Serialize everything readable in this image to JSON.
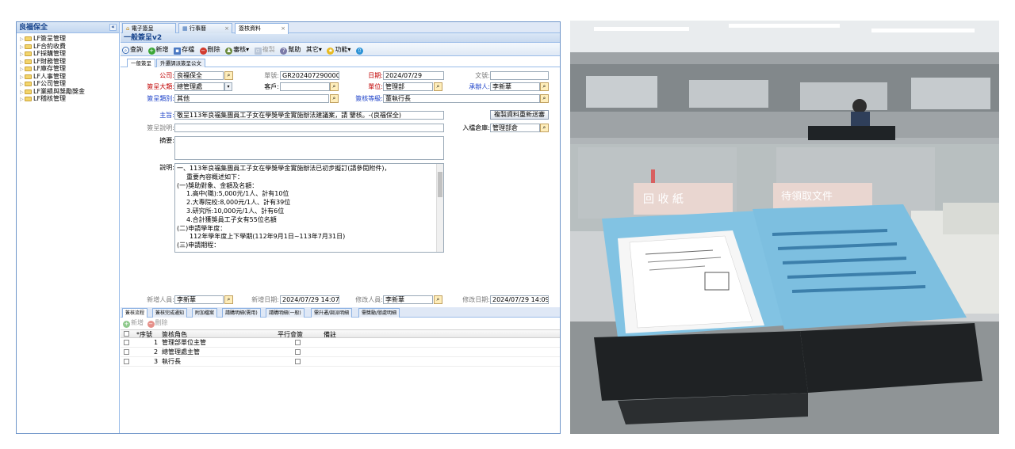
{
  "sidebar": {
    "title": "良福保全",
    "collapse": "«",
    "items": [
      "LF簽呈管理",
      "LF合約收費",
      "LF採購管理",
      "LF財務管理",
      "LF庫存管理",
      "LF人事管理",
      "LF公司管理",
      "LF業績與獎勵獎金",
      "LF稽核管理"
    ]
  },
  "tabs": [
    {
      "label": "電子簽呈",
      "close": ""
    },
    {
      "label": "行事曆",
      "close": "×"
    },
    {
      "label": "簽核資料",
      "close": "×"
    }
  ],
  "panel_title": "一般簽呈v2",
  "toolbar": [
    "查詢",
    "新增",
    "存檔",
    "刪除",
    "審核▾",
    "複製",
    "幫助",
    "其它▾",
    "功能▾",
    ""
  ],
  "subtabs": [
    "一般簽呈",
    "升遷調派簽呈公文"
  ],
  "form": {
    "company_label": "公司:",
    "company_value": "良福保全",
    "docno_label": "單號:",
    "docno_value": "GR2024072900007",
    "date_label": "日期:",
    "date_value": "2024/07/29",
    "wenhao_label": "文號:",
    "wenhao_value": "",
    "category_label": "簽呈大類:",
    "category_value": "總管理處",
    "customer_label": "客戶:",
    "customer_value": "",
    "unit_label": "單位:",
    "unit_value": "管理部",
    "handler_label": "承辦人:",
    "handler_value": "李新華",
    "type_label": "簽呈類別:",
    "type_value": "其他",
    "level_label": "簽核等級:",
    "level_value": "董執行長",
    "subject_label": "主旨:",
    "subject_value": "敬呈113年良福集團員工子女在學獎學金實施辦法建議案，請 鑒核。-(良福保全)",
    "copy_btn": "複製資料重新送審",
    "note_label": "簽呈說明:",
    "note_value": "",
    "archive_label": "入檔倉庫:",
    "archive_value": "管理部倉",
    "summary_label": "摘要:",
    "desc_label": "說明:",
    "desc_lines": [
      "一、113年良福集團員工子女在學獎學金實施辦法已初步擬訂(請參閱附件)，",
      "    重要內容概述如下：",
      "(一)獎助對象、金額及名額：",
      "    1.高中(職):5,000元/1人、計有10位",
      "    2.大專院校:8,000元/1人、計有39位",
      "    3.研究所:10,000元/1人、計有6位",
      "    4.合計獲獎員工子女有55位名額",
      "(二)申請學年度：",
      "    112年學年度上下學期(112年9月1日~113年7月31日)",
      "(三)申請期程："
    ],
    "creator_label": "新增人員:",
    "creator_value": "李新華",
    "created_label": "新增日期:",
    "created_value": "2024/07/29 14:07",
    "modifier_label": "修改人員:",
    "modifier_value": "李新華",
    "modified_label": "修改日期:",
    "modified_value": "2024/07/29 14:09"
  },
  "grid_tabs": [
    "簽核流程",
    "簽核完成通知",
    "附加檔案",
    "請購明細(需用)",
    "請購明細(一般)",
    "需升遷/調派明細",
    "需獎勵/懲處明細"
  ],
  "grid_toolbar": {
    "add": "新增",
    "delete": "刪除"
  },
  "grid": {
    "headers": [
      "*序號",
      "簽核角色",
      "平行會簽",
      "備註"
    ],
    "rows": [
      {
        "no": "1",
        "role": "管理部單位主管"
      },
      {
        "no": "2",
        "role": "總管理處主管"
      },
      {
        "no": "3",
        "role": "執行長"
      }
    ]
  },
  "photo": {
    "sign_left": "回 收 紙",
    "sign_right": "待領取文件"
  },
  "colors": {
    "accent": "#15428b",
    "required": "#c00000",
    "label_blue": "#1a3fc8",
    "tray": "#7fbfe0"
  }
}
